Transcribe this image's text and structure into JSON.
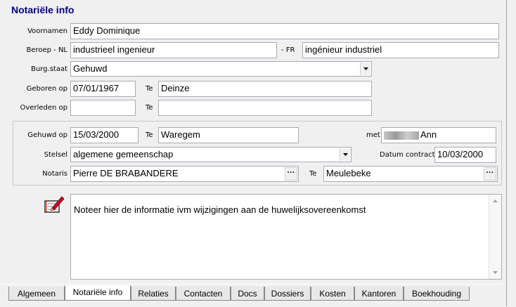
{
  "title": "Notariële info",
  "fields": {
    "voornamen_label": "Voornamen",
    "voornamen": "Eddy Dominique",
    "beroep_nl_label": "Beroep - NL",
    "beroep_nl": "industrieel ingenieur",
    "beroep_fr_label": "- FR",
    "beroep_fr": "ingénieur industriel",
    "burgstaat_label": "Burg.staat",
    "burgstaat": "Gehuwd",
    "geboren_label": "Geboren op",
    "geboren": "07/01/1967",
    "geboren_te_label": "Te",
    "geboren_te": "Deinze",
    "overleden_label": "Overleden op",
    "overleden": "",
    "overleden_te_label": "Te",
    "overleden_te": ""
  },
  "huwelijk": {
    "gehuwd_label": "Gehuwd op",
    "gehuwd": "15/03/2000",
    "gehuwd_te_label": "Te",
    "gehuwd_te": "Waregem",
    "met_label": "met",
    "met": "Ann",
    "stelsel_label": "Stelsel",
    "stelsel": "algemene gemeenschap",
    "datum_contract_label": "Datum contract",
    "datum_contract": "10/03/2000",
    "notaris_label": "Notaris",
    "notaris": "Pierre DE BRABANDERE",
    "notaris_te_label": "Te",
    "notaris_te": "Meulebeke"
  },
  "memo": {
    "text": "Noteer hier de informatie ivm wijzigingen aan de huwelijksovereenkomst",
    "icon": "notepad-pencil-icon"
  },
  "tabs": [
    "Algemeen",
    "Notariële info",
    "Relaties",
    "Contacten",
    "Docs",
    "Dossiers",
    "Kosten",
    "Kantoren",
    "Boekhouding"
  ],
  "active_tab": "Notariële info"
}
